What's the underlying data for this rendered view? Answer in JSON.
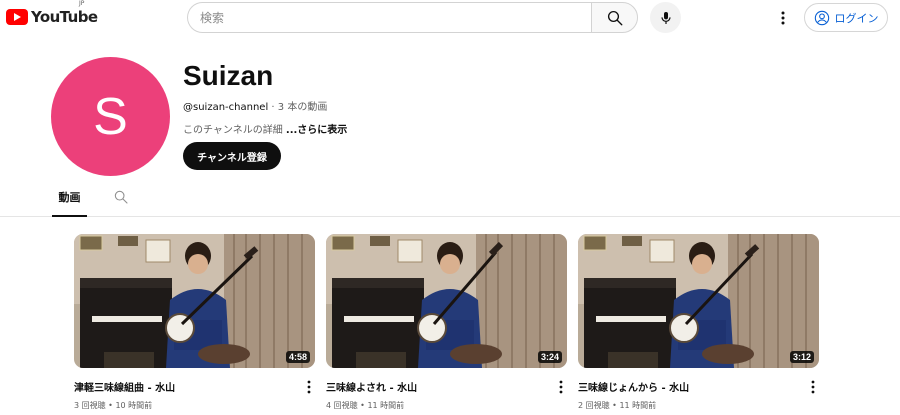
{
  "header": {
    "logo_text": "YouTube",
    "region": "JP",
    "search_placeholder": "検索",
    "login_label": "ログイン",
    "icons": [
      "search-icon",
      "mic-icon",
      "more-vert-icon",
      "account-icon"
    ]
  },
  "channel": {
    "avatar_letter": "S",
    "avatar_color": "#ec407a",
    "name": "Suizan",
    "handle": "@suizan-channel",
    "separator": " · ",
    "video_count": "3 本の動画",
    "description": "このチャンネルの詳細 ",
    "more_label": "...さらに表示",
    "subscribe_label": "チャンネル登録"
  },
  "tabs": {
    "videos": "動画"
  },
  "videos": [
    {
      "title": "津軽三味線組曲 - 水山",
      "views": "3 回視聴",
      "age": "10 時間前",
      "duration": "4:58"
    },
    {
      "title": "三味線よされ - 水山",
      "views": "4 回視聴",
      "age": "11 時間前",
      "duration": "3:24"
    },
    {
      "title": "三味線じょんから - 水山",
      "views": "2 回視聴",
      "age": "11 時間前",
      "duration": "3:12"
    }
  ],
  "stats_separator": " • ",
  "colors": {
    "brand_red": "#ff0000",
    "link_blue": "#065fd4",
    "subscribe_bg": "#0f0f0f"
  }
}
